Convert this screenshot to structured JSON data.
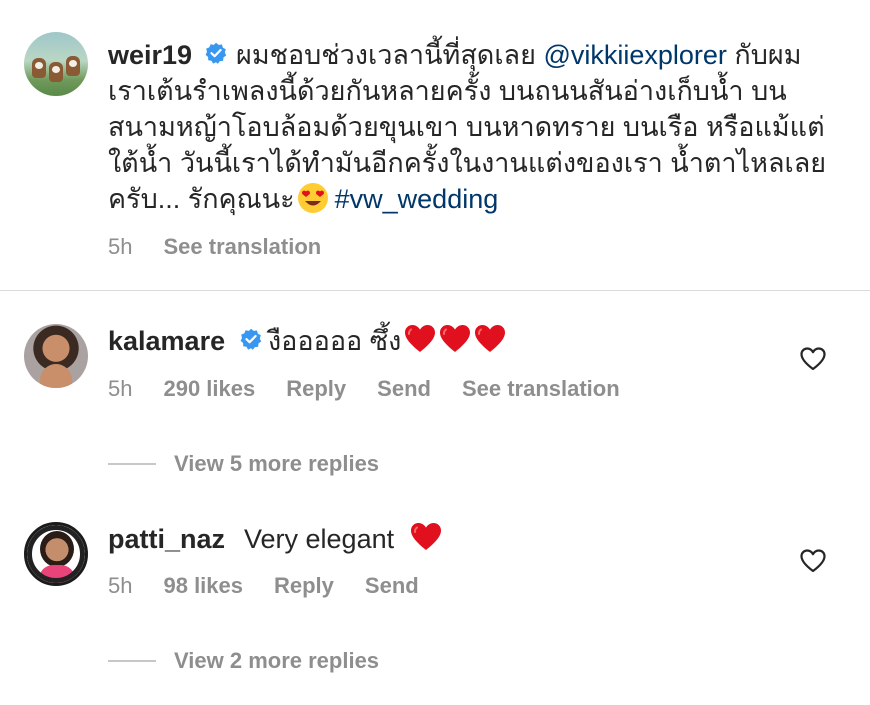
{
  "post": {
    "username": "weir19",
    "caption_lines": [
      "ผมชอบช่วงเวลานี้ที่สุดเลย",
      "เราเต้นรำเพลงนี้ด้วยกันหลายครั้ง บนถนนสันอ่างเก็บน้ำ บน",
      "สนามหญ้าโอบล้อมด้วยขุนเขา บนหาดทราย บนเรือ หรือแม้แต่",
      "ใต้น้ำ วันนี้เราได้ทำมันอีกครั้งในงานแต่งของเรา น้ำตาไหลเลย",
      "ครับ... รักคุณนะ"
    ],
    "mention": "@vikkiiexplorer",
    "mention_suffix": "กับผม",
    "hashtag": "#vw_wedding",
    "time": "5h",
    "see_translation": "See translation",
    "emoji": "heart-eyes-emoji"
  },
  "comments": [
    {
      "username": "kalamare",
      "text": "งือออออ ซึ้ง",
      "time": "5h",
      "likes": "290 likes",
      "reply": "Reply",
      "send": "Send",
      "see_translation": "See translation",
      "view_more": "View 5 more replies",
      "emoji": "red-heart-emoji"
    },
    {
      "username": "patti_naz",
      "text": "Very elegant",
      "time": "5h",
      "likes": "98 likes",
      "reply": "Reply",
      "send": "Send",
      "view_more": "View 2 more replies",
      "emoji": "red-heart-emoji"
    }
  ],
  "colors": {
    "text": "#262626",
    "meta": "#8e8e8e",
    "link": "#00376b",
    "verified": "#3897f0",
    "heart": "#e0101e"
  }
}
